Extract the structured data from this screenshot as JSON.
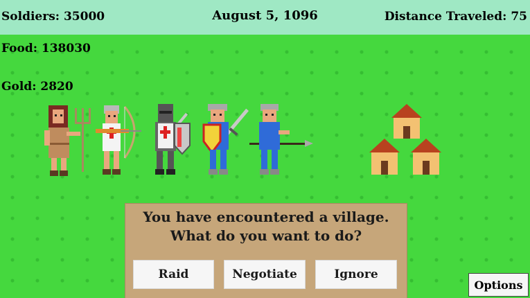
{
  "hud": {
    "soldiers": "Soldiers: 35000",
    "date": "August 5, 1096",
    "distance": "Distance Traveled: 75",
    "food": "Food: 138030",
    "gold": "Gold: 2820"
  },
  "party": [
    "peasant-with-pitchfork",
    "archer-with-bow",
    "knight-with-shield",
    "swordsman",
    "spearman"
  ],
  "event": {
    "message_line1": "You have encountered a village.",
    "message_line2": "What do you want to do?",
    "choices": [
      "Raid",
      "Negotiate",
      "Ignore"
    ]
  },
  "options_label": "Options",
  "colors": {
    "grass": "#45d83e",
    "topbar": "#9fe8c4",
    "dialog": "#c6a67a",
    "button": "#f6f6f6"
  }
}
